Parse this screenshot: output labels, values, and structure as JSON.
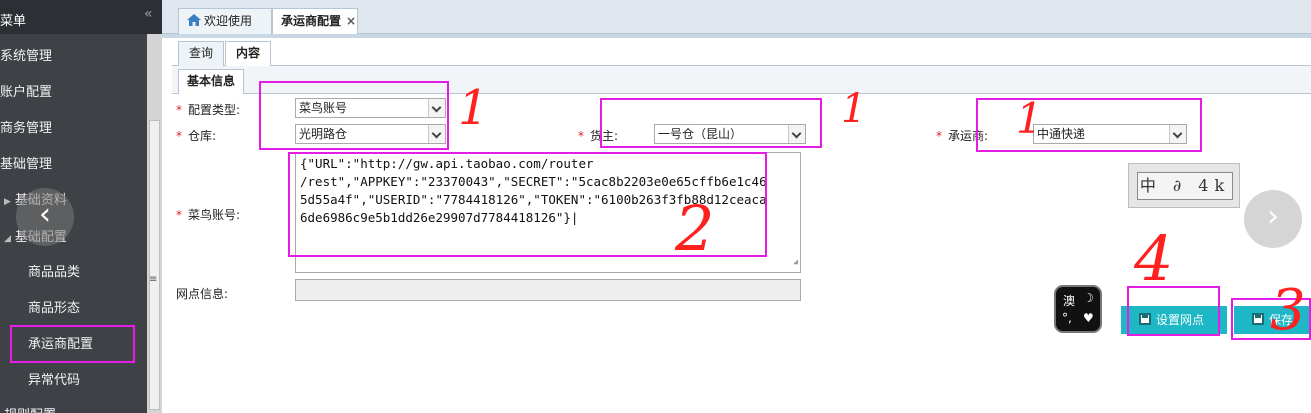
{
  "sidebar": {
    "title": "菜单",
    "collapse_icon": "«",
    "items": [
      "系统管理",
      "账户配置",
      "商务管理",
      "基础管理",
      "基础资料",
      "基础配置"
    ],
    "sub_items": [
      "商品品类",
      "商品形态",
      "承运商配置",
      "异常代码"
    ],
    "more_item": "规则配置",
    "prev_icon": "‹",
    "grip_icon": "≡"
  },
  "tabs": {
    "home_label": "欢迎使用",
    "active_label": "承运商配置",
    "close_icon": "×"
  },
  "subtabs": [
    "查询",
    "内容"
  ],
  "group_tab": "基本信息",
  "form": {
    "config_type_label": "配置类型:",
    "config_type_value": "菜鸟账号",
    "warehouse_label": "仓库:",
    "warehouse_value": "光明路仓",
    "owner_label": "货主:",
    "owner_value": "一号仓（昆山）",
    "carrier_label": "承运商:",
    "carrier_value": "中通快递",
    "cainiao_label": "菜鸟账号:",
    "cainiao_value_lines": [
      "{\"URL\":\"http://gw.api.taobao.com/router",
      "/rest\",\"APPKEY\":\"23370043\",\"SECRET\":\"5cac8b2203e0e65cffb6e1c46",
      "5d55a4f\",\"USERID\":\"7784418126\",\"TOKEN\":\"6100b263f3fb88d12ceaca",
      "6de6986c9e5b1dd26e29907d7784418126\"}|"
    ],
    "network_label": "网点信息:"
  },
  "captcha_text": "中 ∂ 4k",
  "next_icon": "›",
  "ime": {
    "top_left": "澳",
    "top_right": "☽",
    "bottom_left": "°,",
    "bottom_right": "♥"
  },
  "buttons": {
    "set_network": "设置网点",
    "save": "保存"
  },
  "annotations": {
    "a1": "1",
    "a2": "1",
    "a3": "1",
    "a4": "2",
    "a5": "4",
    "a6": "3"
  },
  "colors": {
    "accent": "#1db7c6",
    "annotation_box": "#e51ce5",
    "annotation_text": "#ff2020",
    "required": "#d22222"
  }
}
